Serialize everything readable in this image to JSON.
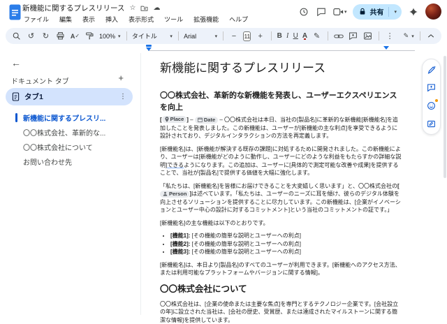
{
  "header": {
    "doc_title": "新機能に関するプレスリリース",
    "menus": [
      "ファイル",
      "編集",
      "表示",
      "挿入",
      "表示形式",
      "ツール",
      "拡張機能",
      "ヘルプ"
    ],
    "share_label": "共有"
  },
  "toolbar": {
    "zoom": "100%",
    "style_name": "タイトル",
    "font_name": "Arial",
    "font_size": "11",
    "minus": "−",
    "plus": "+",
    "bold": "B",
    "italic": "I",
    "underline": "U",
    "text_color": "A",
    "more": "⋮"
  },
  "sidebar": {
    "header": "ドキュメント タブ",
    "add": "+",
    "back": "←",
    "tab_label": "タブ1",
    "kebab": "⋮",
    "outline": [
      {
        "label": "新機能に関するプレスリ..."
      },
      {
        "label": "〇〇株式会社、革新的な..."
      },
      {
        "label": "〇〇株式会社について"
      },
      {
        "label": "お問い合わせ先"
      }
    ]
  },
  "doc": {
    "title": "新機能に関するプレスリリース",
    "subtitle": "〇〇株式会社、革新的な新機能を発表し、ユーザーエクスペリエンスを向上",
    "p1": {
      "open": "[",
      "place_chip": "Place",
      "close": "]",
      "dash": " – ",
      "date_chip": "Date",
      "text": "〇〇株式会社は本日、当社の[製品名]に革新的な新機能[新機能名]を追加したことを発表しました。この新機能は、ユーザーが[新機能の主な利点]を享受できるように設計されており、デジタルインタラクションの方法を再定義します。"
    },
    "p2": {
      "a": "[新機能名]は、[新機能が解決する既存の課題]に対処するために開発されました。この新機能により、ユーザーは[新機能がどのように動作し、ユーザーにどのような利益をもたらすかの詳細な説明]",
      "underlined": "できる",
      "b": "ようになります。この追加は、ユーザーに[具体的で測定可能な改善や成果]を提供することで、当社が[製品名]で提供する価値を大幅に強化します。"
    },
    "p3": {
      "a": "「私たちは、[新機能名]を皆様にお届けできることを大変嬉しく思います」と、〇〇株式会社の",
      "open": "[",
      "person_chip": "Person",
      "close": "]",
      "b": "は述べています。「私たちは、ユーザーのニーズに耳を傾け、彼らのデジタル体験を向上させるソリューションを提供することに尽力しています。この新機能は、[企業がイノベーションとユーザー中心の設計に対するコミットメント]という当社のコミットメントの証です。」"
    },
    "p4": "[新機能名]の主な機能は以下のとおりです。",
    "bullets": [
      {
        "bold": "[機能1]:",
        "rest": " [その機能の簡単な説明とユーザーへの利点]"
      },
      {
        "bold": "[機能2]:",
        "rest": " [その機能の簡単な説明とユーザーへの利点]"
      },
      {
        "bold": "[機能3]:",
        "rest": " [その機能の簡単な説明とユーザーへの利点]"
      }
    ],
    "p5": "[新機能名]は、本日より[製品名]のすべてのユーザーが利用できます。[新機能へのアクセス方法、または利用可能なプラットフォームやバージョンに関する情報]。",
    "h2": "〇〇株式会社について",
    "p6": "〇〇株式会社は、[企業の使命または主要な焦点]を専門とするテクノロジー企業です。[会社設立の年]に設立された当社は、[会社の歴史、受賞歴、または達成されたマイルストーンに関する簡潔な情報]を提供しています。"
  },
  "icons": {
    "star": "☆",
    "cloud": "☁",
    "undo": "↺",
    "redo": "↻",
    "highlighter": "✎",
    "edit_pencil": "✎",
    "check": "✓",
    "spell_letter": "A"
  },
  "colors": {
    "accent_blue": "#0b57d0",
    "share_bg": "#c2e7ff",
    "toolbar_bg": "#edf2fa",
    "tab_selected_bg": "#d3e3fd",
    "ruler_marker": "#1a73e8",
    "notification_dot": "#f29900"
  }
}
